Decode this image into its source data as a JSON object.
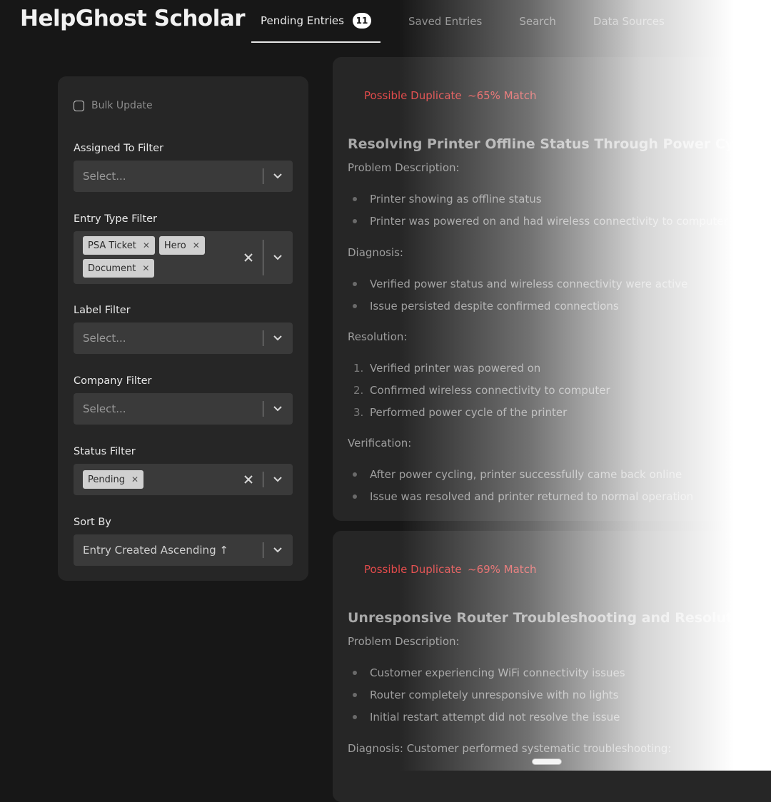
{
  "app": {
    "title": "HelpGhost Scholar"
  },
  "nav": {
    "tabs": [
      {
        "label": "Pending Entries",
        "badge": "11"
      },
      {
        "label": "Saved Entries"
      },
      {
        "label": "Search"
      },
      {
        "label": "Data Sources"
      }
    ]
  },
  "sidebar": {
    "bulk_update": "Bulk Update",
    "assigned_to": {
      "label": "Assigned To Filter",
      "placeholder": "Select..."
    },
    "entry_type": {
      "label": "Entry Type Filter",
      "chips": [
        "PSA Ticket",
        "Hero",
        "Document"
      ]
    },
    "label_filter": {
      "label": "Label Filter",
      "placeholder": "Select..."
    },
    "company": {
      "label": "Company Filter",
      "placeholder": "Select..."
    },
    "status": {
      "label": "Status Filter",
      "chips": [
        "Pending"
      ]
    },
    "sort_by": {
      "label": "Sort By",
      "value": "Entry Created Ascending ↑"
    }
  },
  "cards": [
    {
      "flag": "Possible Duplicate",
      "match": "~65% Match",
      "title": "Resolving Printer Offline Status Through Power Cycling",
      "problem_heading": "Problem Description:",
      "problem": [
        "Printer showing as offline status",
        "Printer was powered on and had wireless connectivity to computer"
      ],
      "diagnosis_heading": "Diagnosis:",
      "diagnosis": [
        "Verified power status and wireless connectivity were active",
        "Issue persisted despite confirmed connections"
      ],
      "resolution_heading": "Resolution:",
      "resolution": [
        "Verified printer was powered on",
        "Confirmed wireless connectivity to computer",
        "Performed power cycle of the printer"
      ],
      "verification_heading": "Verification:",
      "verification": [
        "After power cycling, printer successfully came back online",
        "Issue was resolved and printer returned to normal operation"
      ]
    },
    {
      "flag": "Possible Duplicate",
      "match": "~69% Match",
      "title": "Unresponsive Router Troubleshooting and Resolution",
      "problem_heading": "Problem Description:",
      "problem": [
        "Customer experiencing WiFi connectivity issues",
        "Router completely unresponsive with no lights",
        "Initial restart attempt did not resolve the issue"
      ],
      "diagnosis_heading": "Diagnosis: Customer performed systematic troubleshooting:"
    }
  ],
  "colors": {
    "accent_red": "#e24b4b",
    "card_bg": "#262626",
    "page_bg": "#171717"
  }
}
